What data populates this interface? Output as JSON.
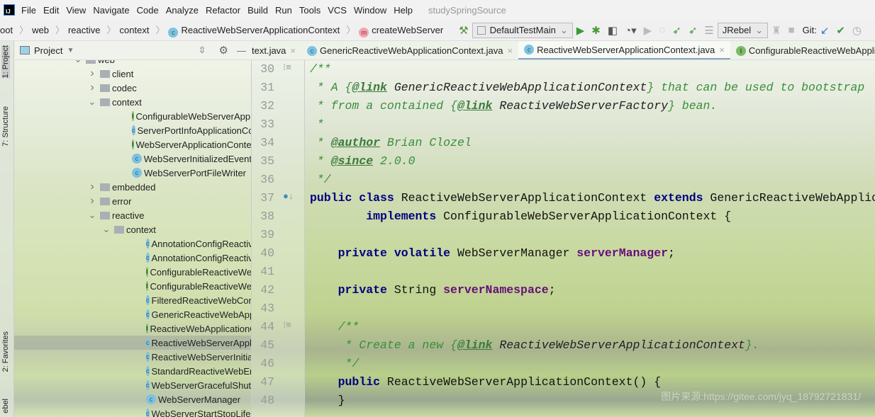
{
  "app": {
    "project_title": "studySpringSource",
    "logo_text": "IJ"
  },
  "menu": [
    "File",
    "Edit",
    "View",
    "Navigate",
    "Code",
    "Analyze",
    "Refactor",
    "Build",
    "Run",
    "Tools",
    "VCS",
    "Window",
    "Help"
  ],
  "breadcrumb": [
    {
      "label": "oot"
    },
    {
      "label": "web"
    },
    {
      "label": "reactive"
    },
    {
      "label": "context"
    },
    {
      "label": "ReactiveWebServerApplicationContext",
      "icon": "c"
    },
    {
      "label": "createWebServer",
      "icon": "m"
    }
  ],
  "toolbar": {
    "run_config": "DefaultTestMain",
    "jrebel": "JRebel",
    "git_label": "Git:"
  },
  "tool_stripe": {
    "project": "1: Project",
    "structure": "7: Structure",
    "favorites": "2: Favorites",
    "jrebel": "ebel"
  },
  "project_panel": {
    "title": "Project"
  },
  "tree": [
    {
      "label": "web",
      "type": "folder",
      "depth": 0,
      "expanded": true
    },
    {
      "label": "client",
      "type": "folder",
      "depth": 1,
      "expanded": false
    },
    {
      "label": "codec",
      "type": "folder",
      "depth": 1,
      "expanded": false
    },
    {
      "label": "context",
      "type": "folder",
      "depth": 1,
      "expanded": true
    },
    {
      "label": "ConfigurableWebServerApplic",
      "type": "i",
      "depth": 2
    },
    {
      "label": "ServerPortInfoApplicationCont",
      "type": "c",
      "depth": 2
    },
    {
      "label": "WebServerApplicationContext",
      "type": "i",
      "depth": 2
    },
    {
      "label": "WebServerInitializedEvent",
      "type": "c",
      "depth": 2
    },
    {
      "label": "WebServerPortFileWriter",
      "type": "c",
      "depth": 2
    },
    {
      "label": "embedded",
      "type": "folder",
      "depth": 1,
      "expanded": false
    },
    {
      "label": "error",
      "type": "folder",
      "depth": 1,
      "expanded": false
    },
    {
      "label": "reactive",
      "type": "folder",
      "depth": 1,
      "expanded": true
    },
    {
      "label": "context",
      "type": "folder",
      "depth": 2,
      "expanded": true
    },
    {
      "label": "AnnotationConfigReactiveW",
      "type": "c",
      "depth": 3
    },
    {
      "label": "AnnotationConfigReactiveW",
      "type": "c",
      "depth": 3
    },
    {
      "label": "ConfigurableReactiveWebA",
      "type": "i",
      "depth": 3
    },
    {
      "label": "ConfigurableReactiveWebE",
      "type": "i",
      "depth": 3
    },
    {
      "label": "FilteredReactiveWebConte",
      "type": "c",
      "depth": 3
    },
    {
      "label": "GenericReactiveWebApplic",
      "type": "c",
      "depth": 3
    },
    {
      "label": "ReactiveWebApplicationCo",
      "type": "i",
      "depth": 3
    },
    {
      "label": "ReactiveWebServerApplica",
      "type": "c",
      "depth": 3,
      "selected": true
    },
    {
      "label": "ReactiveWebServerInitializ",
      "type": "c",
      "depth": 3
    },
    {
      "label": "StandardReactiveWebEnvi",
      "type": "c",
      "depth": 3
    },
    {
      "label": "WebServerGracefulShutdo",
      "type": "c",
      "depth": 3
    },
    {
      "label": "WebServerManager",
      "type": "c",
      "depth": 3
    },
    {
      "label": "WebServerStartStopLifecyc",
      "type": "c",
      "depth": 3
    }
  ],
  "tabs": [
    {
      "label": "text.java",
      "icon": ""
    },
    {
      "label": "GenericReactiveWebApplicationContext.java",
      "icon": "c"
    },
    {
      "label": "ReactiveWebServerApplicationContext.java",
      "icon": "c",
      "active": true
    },
    {
      "label": "ConfigurableReactiveWebApplica",
      "icon": "i"
    }
  ],
  "code": [
    {
      "n": "30",
      "t": [
        [
          "/**",
          "cm"
        ]
      ]
    },
    {
      "n": "31",
      "t": [
        [
          " * A {",
          "cm"
        ],
        [
          "@link",
          "tag"
        ],
        [
          " GenericReactiveWebApplicationContext",
          "ref"
        ],
        [
          "} that can be used to bootstrap",
          "cm"
        ]
      ]
    },
    {
      "n": "32",
      "t": [
        [
          " * from a contained {",
          "cm"
        ],
        [
          "@link",
          "tag"
        ],
        [
          " ReactiveWebServerFactory",
          "ref"
        ],
        [
          "} bean.",
          "cm"
        ]
      ]
    },
    {
      "n": "33",
      "t": [
        [
          " *",
          "cm"
        ]
      ]
    },
    {
      "n": "34",
      "t": [
        [
          " * ",
          "cm"
        ],
        [
          "@author",
          "tag"
        ],
        [
          " Brian Clozel",
          "cm"
        ]
      ]
    },
    {
      "n": "35",
      "t": [
        [
          " * ",
          "cm"
        ],
        [
          "@since",
          "tag"
        ],
        [
          " 2.0.0",
          "cm"
        ]
      ]
    },
    {
      "n": "36",
      "t": [
        [
          " */",
          "cm"
        ]
      ]
    },
    {
      "n": "37",
      "t": [
        [
          "public class",
          "kw"
        ],
        [
          " ReactiveWebServerApplicationContext ",
          "pl"
        ],
        [
          "extends",
          "kw"
        ],
        [
          " GenericReactiveWebApplicationContext",
          "pl"
        ]
      ]
    },
    {
      "n": "38",
      "t": [
        [
          "        ",
          "pl"
        ],
        [
          "implements",
          "kw"
        ],
        [
          " ConfigurableWebServerApplicationContext {",
          "pl"
        ]
      ]
    },
    {
      "n": "39",
      "t": []
    },
    {
      "n": "40",
      "t": [
        [
          "    ",
          "pl"
        ],
        [
          "private volatile",
          "kw"
        ],
        [
          " WebServerManager ",
          "pl"
        ],
        [
          "serverManager",
          "fld"
        ],
        [
          ";",
          "pl"
        ]
      ]
    },
    {
      "n": "41",
      "t": []
    },
    {
      "n": "42",
      "t": [
        [
          "    ",
          "pl"
        ],
        [
          "private",
          "kw"
        ],
        [
          " String ",
          "pl"
        ],
        [
          "serverNamespace",
          "fld"
        ],
        [
          ";",
          "pl"
        ]
      ]
    },
    {
      "n": "43",
      "t": []
    },
    {
      "n": "44",
      "t": [
        [
          "    /**",
          "cm"
        ]
      ]
    },
    {
      "n": "45",
      "t": [
        [
          "     * Create a new {",
          "cm"
        ],
        [
          "@link",
          "tag"
        ],
        [
          " ReactiveWebServerApplicationContext",
          "ref"
        ],
        [
          "}.",
          "cm"
        ]
      ]
    },
    {
      "n": "46",
      "t": [
        [
          "     */",
          "cm"
        ]
      ]
    },
    {
      "n": "47",
      "t": [
        [
          "    ",
          "pl"
        ],
        [
          "public",
          "kw"
        ],
        [
          " ReactiveWebServerApplicationContext() {",
          "pl"
        ]
      ]
    },
    {
      "n": "48",
      "t": [
        [
          "    }",
          "pl"
        ]
      ]
    }
  ],
  "watermark": "图片来源:https://gitee.com/jyq_18792721831/"
}
